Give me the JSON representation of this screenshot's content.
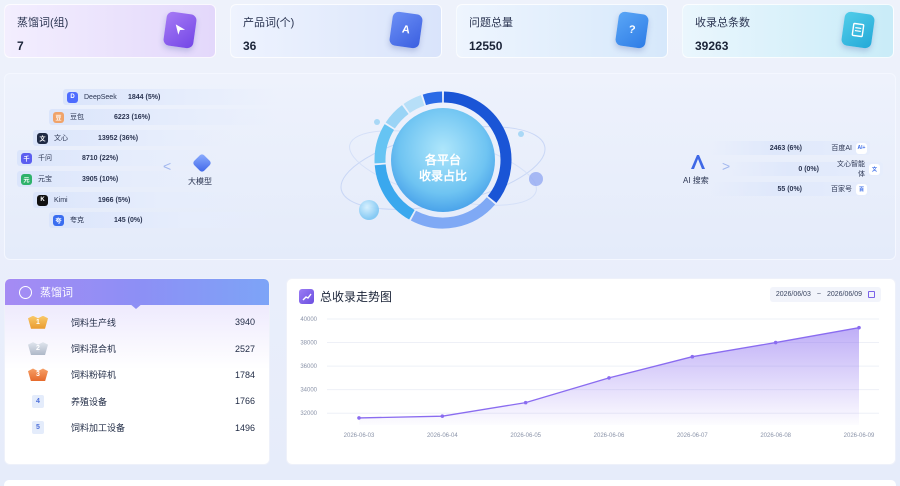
{
  "stats": [
    {
      "label": "蒸馏词(组)",
      "value": "7",
      "icon": "cursor-icon"
    },
    {
      "label": "产品词(个)",
      "value": "36",
      "icon": "letter-a-icon"
    },
    {
      "label": "问题总量",
      "value": "12550",
      "icon": "question-icon"
    },
    {
      "label": "收录总条数",
      "value": "39263",
      "icon": "document-icon"
    }
  ],
  "platforms_center": {
    "line1": "各平台",
    "line2": "收录占比"
  },
  "large_models": {
    "label": "大模型",
    "items": [
      {
        "name": "DeepSeek",
        "value": "1844 (5%)",
        "icon_color": "#4d6bfe",
        "glyph": "D"
      },
      {
        "name": "豆包",
        "value": "6223 (16%)",
        "icon_color": "#f0a36a",
        "glyph": "豆"
      },
      {
        "name": "文心",
        "value": "13952 (36%)",
        "icon_color": "#1f2a44",
        "glyph": "文"
      },
      {
        "name": "千问",
        "value": "8710 (22%)",
        "icon_color": "#5b5ef0",
        "glyph": "千"
      },
      {
        "name": "元宝",
        "value": "3905 (10%)",
        "icon_color": "#2fb26b",
        "glyph": "元"
      },
      {
        "name": "Kimi",
        "value": "1966 (5%)",
        "icon_color": "#111111",
        "glyph": "K"
      },
      {
        "name": "夸克",
        "value": "145 (0%)",
        "icon_color": "#3a6df0",
        "glyph": "夸"
      }
    ]
  },
  "ai_search": {
    "label": "AI 搜索",
    "items": [
      {
        "name": "百度AI",
        "value": "2463 (6%)",
        "glyph": "AI+"
      },
      {
        "name": "文心智能体",
        "value": "0 (0%)",
        "glyph": "文"
      },
      {
        "name": "百家号",
        "value": "55 (0%)",
        "glyph": "百"
      }
    ]
  },
  "donut_segments": [
    {
      "name": "文心",
      "percent": 36,
      "color": "#1a55d6"
    },
    {
      "name": "千问",
      "percent": 22,
      "color": "#7fa9f5"
    },
    {
      "name": "豆包",
      "percent": 16,
      "color": "#3aa8ee"
    },
    {
      "name": "元宝",
      "percent": 10,
      "color": "#66c4f3"
    },
    {
      "name": "百度AI",
      "percent": 6,
      "color": "#9ad4f6"
    },
    {
      "name": "DeepSeek",
      "percent": 5,
      "color": "#b7dff8"
    },
    {
      "name": "Kimi",
      "percent": 5,
      "color": "#2b6be6"
    }
  ],
  "distill": {
    "title": "蒸馏词",
    "rows": [
      {
        "rank": "1",
        "name": "饲料生产线",
        "value": "3940",
        "badge": "gold"
      },
      {
        "rank": "2",
        "name": "饲料混合机",
        "value": "2527",
        "badge": "silver"
      },
      {
        "rank": "3",
        "name": "饲料粉碎机",
        "value": "1784",
        "badge": "bronze"
      },
      {
        "rank": "4",
        "name": "养殖设备",
        "value": "1766",
        "badge": "plain"
      },
      {
        "rank": "5",
        "name": "饲料加工设备",
        "value": "1496",
        "badge": "plain"
      }
    ]
  },
  "trend": {
    "title": "总收录走势图",
    "date_start": "2026/06/03",
    "date_sep": "~",
    "date_end": "2026/06/09"
  },
  "chart_data": {
    "type": "area",
    "title": "总收录走势图",
    "x": [
      "2026-06-03",
      "2026-06-04",
      "2026-06-05",
      "2026-06-06",
      "2026-06-07",
      "2026-06-08",
      "2026-06-09"
    ],
    "values": [
      31600,
      31750,
      32900,
      35000,
      36800,
      38000,
      39263
    ],
    "yticks": [
      32000,
      34000,
      36000,
      38000,
      40000
    ],
    "ylim": [
      31000,
      40000
    ],
    "line_color": "#8a6cf0",
    "grid": true
  }
}
